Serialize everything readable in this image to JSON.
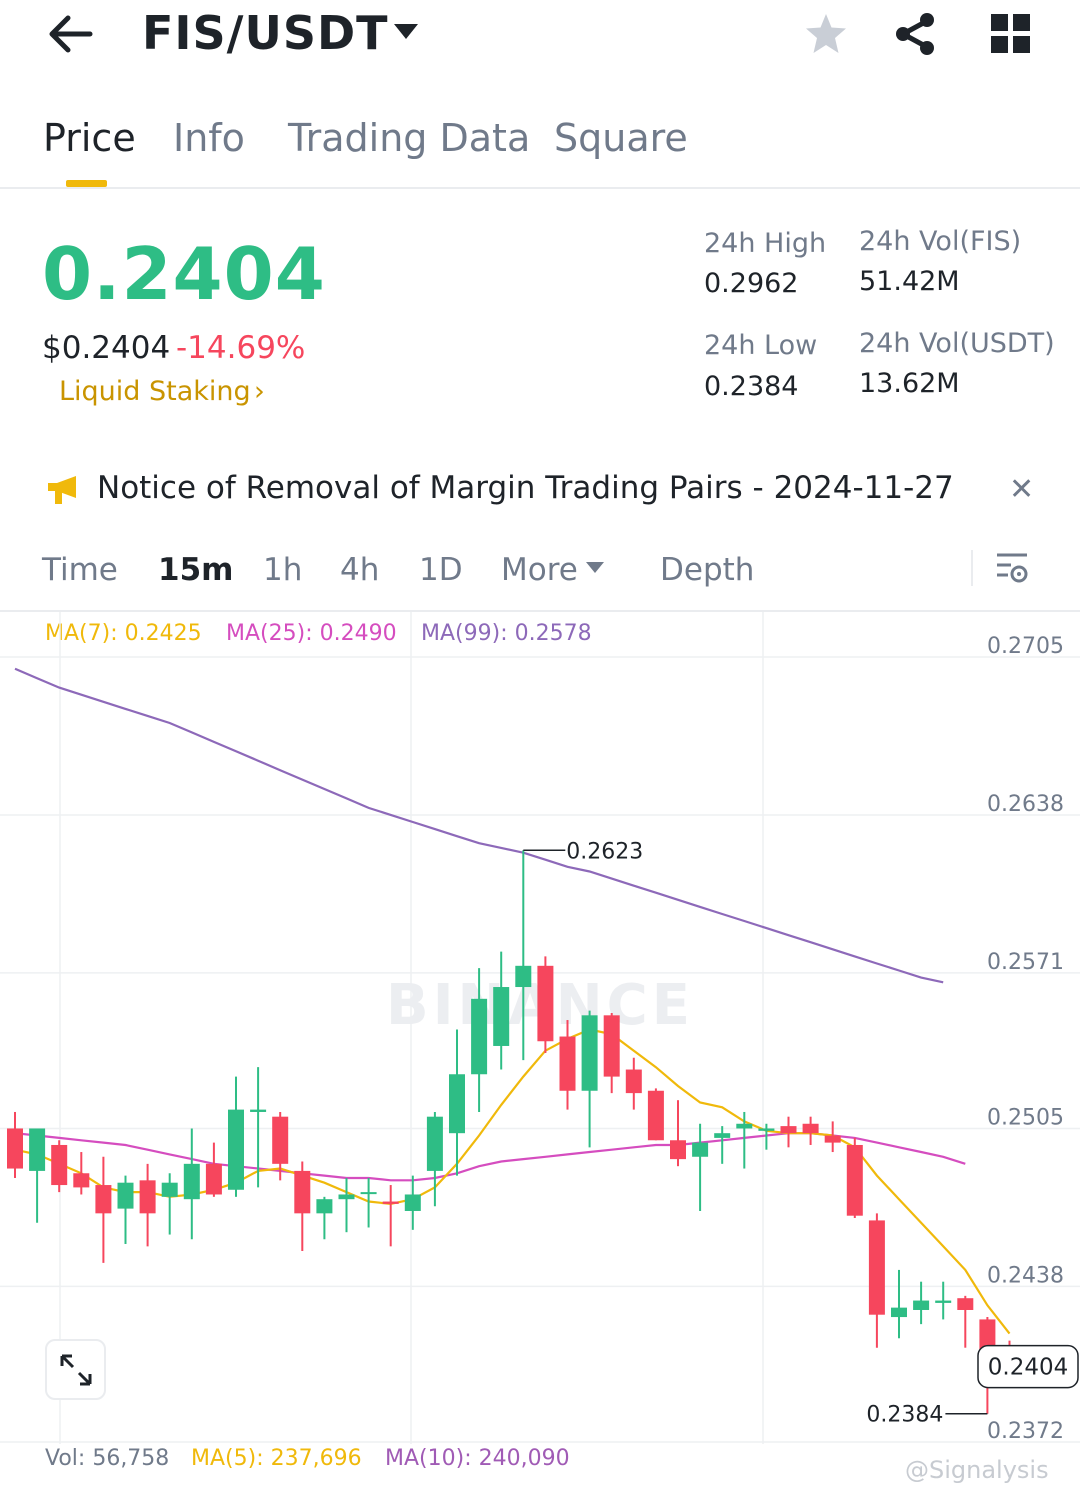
{
  "header": {
    "pair": "FIS/USDT",
    "icons": [
      "back-arrow-icon",
      "caret-down-icon",
      "star-icon",
      "share-icon",
      "grid-icon"
    ]
  },
  "tabs": [
    {
      "label": "Price",
      "active": true
    },
    {
      "label": "Info",
      "active": false
    },
    {
      "label": "Trading Data",
      "active": false
    },
    {
      "label": "Square",
      "active": false
    }
  ],
  "price": {
    "last": "0.2404",
    "usd": "$0.2404",
    "change": "-14.69%",
    "tag": "Liquid Staking",
    "tag_chevron": "›",
    "up_color": "#2ebd85",
    "down_color": "#f6465d"
  },
  "stats": {
    "high_label": "24h High",
    "high": "0.2962",
    "low_label": "24h Low",
    "low": "0.2384",
    "vol_base_label": "24h Vol(FIS)",
    "vol_base": "51.42M",
    "vol_quote_label": "24h Vol(USDT)",
    "vol_quote": "13.62M"
  },
  "notice": {
    "text": "Notice of Removal of Margin Trading Pairs - 2024-11-27",
    "close": "✕"
  },
  "intervals": [
    {
      "label": "Time",
      "active": false
    },
    {
      "label": "15m",
      "active": true
    },
    {
      "label": "1h",
      "active": false
    },
    {
      "label": "4h",
      "active": false
    },
    {
      "label": "1D",
      "active": false
    },
    {
      "label": "More",
      "active": false
    },
    {
      "label": "Depth",
      "active": false
    }
  ],
  "ma_labels": {
    "ma7": "MA(7): 0.2425",
    "ma25": "MA(25): 0.2490",
    "ma99": "MA(99): 0.2578",
    "ma7_color": "#f0b90b",
    "ma25_color": "#d54dbf",
    "ma99_color": "#8d69b9"
  },
  "chart_data": {
    "type": "candlestick",
    "y_ticks": [
      "0.2705",
      "0.2638",
      "0.2571",
      "0.2505",
      "0.2438",
      "0.2372"
    ],
    "ylim": [
      0.2372,
      0.2705
    ],
    "high_marker": "0.2623",
    "low_marker": "0.2384",
    "current_price": "0.2404",
    "watermark": "BINANCE",
    "candles": [
      {
        "o": 0.2505,
        "h": 0.2512,
        "l": 0.2484,
        "c": 0.2488
      },
      {
        "o": 0.2487,
        "h": 0.2502,
        "l": 0.2465,
        "c": 0.2505
      },
      {
        "o": 0.2498,
        "h": 0.25,
        "l": 0.2478,
        "c": 0.2481
      },
      {
        "o": 0.2486,
        "h": 0.2495,
        "l": 0.2477,
        "c": 0.248
      },
      {
        "o": 0.2481,
        "h": 0.2493,
        "l": 0.2448,
        "c": 0.2469
      },
      {
        "o": 0.2471,
        "h": 0.2485,
        "l": 0.2456,
        "c": 0.2482
      },
      {
        "o": 0.2483,
        "h": 0.249,
        "l": 0.2455,
        "c": 0.2469
      },
      {
        "o": 0.2476,
        "h": 0.2486,
        "l": 0.246,
        "c": 0.2482
      },
      {
        "o": 0.2475,
        "h": 0.2505,
        "l": 0.2458,
        "c": 0.249
      },
      {
        "o": 0.249,
        "h": 0.2499,
        "l": 0.2476,
        "c": 0.2477
      },
      {
        "o": 0.2479,
        "h": 0.2527,
        "l": 0.2476,
        "c": 0.2513
      },
      {
        "o": 0.2512,
        "h": 0.2531,
        "l": 0.248,
        "c": 0.2513
      },
      {
        "o": 0.251,
        "h": 0.2512,
        "l": 0.2483,
        "c": 0.249
      },
      {
        "o": 0.2487,
        "h": 0.2491,
        "l": 0.2453,
        "c": 0.2469
      },
      {
        "o": 0.2469,
        "h": 0.2476,
        "l": 0.2458,
        "c": 0.2475
      },
      {
        "o": 0.2475,
        "h": 0.2484,
        "l": 0.2461,
        "c": 0.2477
      },
      {
        "o": 0.2478,
        "h": 0.2484,
        "l": 0.2463,
        "c": 0.2478
      },
      {
        "o": 0.2474,
        "h": 0.2481,
        "l": 0.2455,
        "c": 0.2473
      },
      {
        "o": 0.247,
        "h": 0.2485,
        "l": 0.2462,
        "c": 0.2477
      },
      {
        "o": 0.2487,
        "h": 0.2512,
        "l": 0.2472,
        "c": 0.251
      },
      {
        "o": 0.2503,
        "h": 0.2547,
        "l": 0.2485,
        "c": 0.2528
      },
      {
        "o": 0.2528,
        "h": 0.2573,
        "l": 0.2512,
        "c": 0.256
      },
      {
        "o": 0.254,
        "h": 0.258,
        "l": 0.253,
        "c": 0.2565
      },
      {
        "o": 0.2565,
        "h": 0.2623,
        "l": 0.2534,
        "c": 0.2574
      },
      {
        "o": 0.2574,
        "h": 0.2578,
        "l": 0.2537,
        "c": 0.2542
      },
      {
        "o": 0.2544,
        "h": 0.2551,
        "l": 0.2513,
        "c": 0.2521
      },
      {
        "o": 0.2521,
        "h": 0.2555,
        "l": 0.2497,
        "c": 0.2553
      },
      {
        "o": 0.2553,
        "h": 0.2554,
        "l": 0.252,
        "c": 0.2527
      },
      {
        "o": 0.253,
        "h": 0.2535,
        "l": 0.2513,
        "c": 0.252
      },
      {
        "o": 0.2521,
        "h": 0.2522,
        "l": 0.25,
        "c": 0.25
      },
      {
        "o": 0.25,
        "h": 0.2517,
        "l": 0.2489,
        "c": 0.2492
      },
      {
        "o": 0.2493,
        "h": 0.2507,
        "l": 0.247,
        "c": 0.2499
      },
      {
        "o": 0.2501,
        "h": 0.2506,
        "l": 0.249,
        "c": 0.2503
      },
      {
        "o": 0.2505,
        "h": 0.2512,
        "l": 0.2488,
        "c": 0.2507
      },
      {
        "o": 0.2504,
        "h": 0.2507,
        "l": 0.2496,
        "c": 0.2505
      },
      {
        "o": 0.2506,
        "h": 0.251,
        "l": 0.2497,
        "c": 0.2503
      },
      {
        "o": 0.2507,
        "h": 0.251,
        "l": 0.2498,
        "c": 0.2503
      },
      {
        "o": 0.2502,
        "h": 0.2508,
        "l": 0.2495,
        "c": 0.2499
      },
      {
        "o": 0.2498,
        "h": 0.2501,
        "l": 0.2467,
        "c": 0.2468
      },
      {
        "o": 0.2466,
        "h": 0.2469,
        "l": 0.2412,
        "c": 0.2426
      },
      {
        "o": 0.2425,
        "h": 0.2445,
        "l": 0.2416,
        "c": 0.2429
      },
      {
        "o": 0.2428,
        "h": 0.244,
        "l": 0.2422,
        "c": 0.2432
      },
      {
        "o": 0.2431,
        "h": 0.244,
        "l": 0.2424,
        "c": 0.2432
      },
      {
        "o": 0.2433,
        "h": 0.2434,
        "l": 0.2412,
        "c": 0.2428
      },
      {
        "o": 0.2424,
        "h": 0.2425,
        "l": 0.2384,
        "c": 0.241
      },
      {
        "o": 0.241,
        "h": 0.2415,
        "l": 0.2397,
        "c": 0.2404
      }
    ],
    "ma7": [
      0.2496,
      0.2494,
      0.249,
      0.2486,
      0.248,
      0.2478,
      0.2478,
      0.2476,
      0.2477,
      0.2479,
      0.2482,
      0.2487,
      0.2488,
      0.2485,
      0.2482,
      0.2478,
      0.2474,
      0.2473,
      0.2475,
      0.248,
      0.249,
      0.2502,
      0.2515,
      0.2527,
      0.2538,
      0.2543,
      0.2547,
      0.2545,
      0.2538,
      0.2531,
      0.2523,
      0.2516,
      0.2514,
      0.2508,
      0.2504,
      0.2503,
      0.2503,
      0.2502,
      0.2497,
      0.2485,
      0.2475,
      0.2465,
      0.2455,
      0.2445,
      0.243,
      0.2418
    ],
    "ma25": [
      0.2503,
      0.2502,
      0.2501,
      0.25,
      0.2499,
      0.2498,
      0.2496,
      0.2494,
      0.2492,
      0.249,
      0.2489,
      0.2488,
      0.2487,
      0.2486,
      0.2485,
      0.2484,
      0.2484,
      0.2483,
      0.2483,
      0.2484,
      0.2486,
      0.2489,
      0.2491,
      0.2492,
      0.2493,
      0.2494,
      0.2495,
      0.2496,
      0.2497,
      0.2498,
      0.2498,
      0.2499,
      0.25,
      0.2501,
      0.2502,
      0.2503,
      0.2503,
      0.2502,
      0.2501,
      0.2499,
      0.2497,
      0.2495,
      0.2493,
      0.249
    ],
    "ma99": [
      0.27,
      0.2696,
      0.2692,
      0.2689,
      0.2686,
      0.2683,
      0.268,
      0.2677,
      0.2673,
      0.2669,
      0.2665,
      0.2661,
      0.2657,
      0.2653,
      0.2649,
      0.2645,
      0.2641,
      0.2638,
      0.2635,
      0.2632,
      0.2629,
      0.2626,
      0.2624,
      0.2622,
      0.2619,
      0.2616,
      0.2614,
      0.2611,
      0.2608,
      0.2605,
      0.2602,
      0.2599,
      0.2596,
      0.2593,
      0.259,
      0.2587,
      0.2584,
      0.2581,
      0.2578,
      0.2575,
      0.2572,
      0.2569,
      0.2567
    ]
  },
  "volume": {
    "vol": "Vol: 56,758",
    "ma5": "MA(5): 237,696",
    "ma10": "MA(10): 240,090",
    "vol_color": "#707a8a",
    "ma5_color": "#f0b90b",
    "ma10_color": "#a05bb5"
  },
  "watermark_credit": "@Signalysis"
}
